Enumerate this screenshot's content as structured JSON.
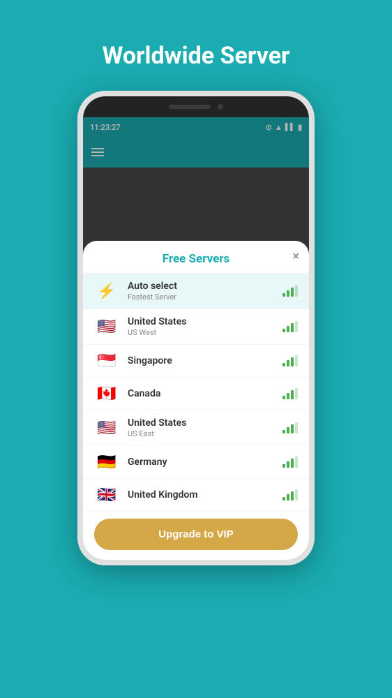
{
  "page": {
    "title": "Worldwide Server",
    "background": "#1AACB0"
  },
  "status_bar": {
    "time": "11:23:27",
    "icons": [
      "location",
      "wifi",
      "signal",
      "battery"
    ]
  },
  "modal": {
    "title": "Free Servers",
    "close_label": "×",
    "servers": [
      {
        "id": "auto",
        "name": "Auto select",
        "sub": "Fastest Server",
        "flag": "⚡",
        "flag_type": "auto",
        "is_auto": true,
        "signal": 3
      },
      {
        "id": "us-west",
        "name": "United States",
        "sub": "US West",
        "flag": "🇺🇸",
        "flag_type": "us",
        "is_auto": false,
        "signal": 3
      },
      {
        "id": "sg",
        "name": "Singapore",
        "sub": "",
        "flag": "🇸🇬",
        "flag_type": "sg",
        "is_auto": false,
        "signal": 3
      },
      {
        "id": "ca",
        "name": "Canada",
        "sub": "",
        "flag": "🇨🇦",
        "flag_type": "ca",
        "is_auto": false,
        "signal": 3
      },
      {
        "id": "us-east",
        "name": "United States",
        "sub": "US East",
        "flag": "🇺🇸",
        "flag_type": "us",
        "is_auto": false,
        "signal": 3
      },
      {
        "id": "de",
        "name": "Germany",
        "sub": "",
        "flag": "🇩🇪",
        "flag_type": "de",
        "is_auto": false,
        "signal": 3
      },
      {
        "id": "uk",
        "name": "United Kingdom",
        "sub": "",
        "flag": "🇬🇧",
        "flag_type": "uk",
        "is_auto": false,
        "signal": 3
      }
    ],
    "vip_button_label": "Upgrade to VIP"
  }
}
